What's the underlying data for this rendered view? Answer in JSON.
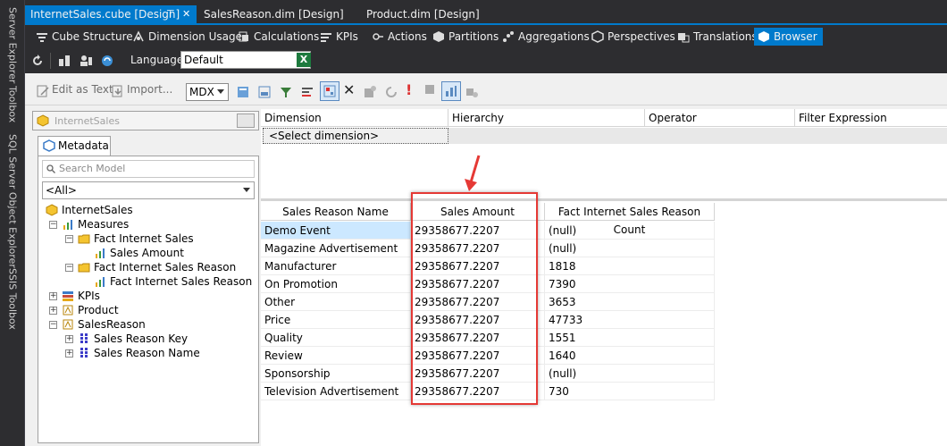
{
  "side_tabs": [
    "Server Explorer",
    "Toolbox",
    "SQL Server Object Explorer",
    "SSIS Toolbox"
  ],
  "doc_tabs": [
    {
      "label": "InternetSales.cube [Design]",
      "active": true
    },
    {
      "label": "SalesReason.dim [Design]",
      "active": false
    },
    {
      "label": "Product.dim [Design]",
      "active": false
    }
  ],
  "designer_tabs": [
    "Cube Structure",
    "Dimension Usage",
    "Calculations",
    "KPIs",
    "Actions",
    "Partitions",
    "Aggregations",
    "Perspectives",
    "Translations",
    "Browser"
  ],
  "toolbar2": {
    "language_label": "Language:",
    "language_value": "Default"
  },
  "toolbar3": {
    "edit_as_text": "Edit as Text",
    "import": "Import...",
    "query_type": "MDX"
  },
  "metadata": {
    "cube_name": "InternetSales",
    "tab_label": "Metadata",
    "search_placeholder": "Search Model",
    "filter_value": "<All>",
    "tree": [
      {
        "label": "InternetSales"
      },
      {
        "label": "Measures"
      },
      {
        "label": "Fact Internet Sales"
      },
      {
        "label": "Sales Amount"
      },
      {
        "label": "Fact Internet Sales Reason"
      },
      {
        "label": "Fact Internet Sales Reason Co"
      },
      {
        "label": "KPIs"
      },
      {
        "label": "Product"
      },
      {
        "label": "SalesReason"
      },
      {
        "label": "Sales Reason Key"
      },
      {
        "label": "Sales Reason Name"
      }
    ]
  },
  "filter": {
    "headers": [
      "Dimension",
      "Hierarchy",
      "Operator",
      "Filter Expression"
    ],
    "select_dimension": "<Select dimension>"
  },
  "results": {
    "headers": [
      "Sales Reason Name",
      "Sales Amount",
      "Fact Internet Sales Reason Count"
    ],
    "rows": [
      [
        "Demo Event",
        "29358677.2207",
        "(null)"
      ],
      [
        "Magazine Advertisement",
        "29358677.2207",
        "(null)"
      ],
      [
        "Manufacturer",
        "29358677.2207",
        "1818"
      ],
      [
        "On Promotion",
        "29358677.2207",
        "7390"
      ],
      [
        "Other",
        "29358677.2207",
        "3653"
      ],
      [
        "Price",
        "29358677.2207",
        "47733"
      ],
      [
        "Quality",
        "29358677.2207",
        "1551"
      ],
      [
        "Review",
        "29358677.2207",
        "1640"
      ],
      [
        "Sponsorship",
        "29358677.2207",
        "(null)"
      ],
      [
        "Television  Advertisement",
        "29358677.2207",
        "730"
      ]
    ]
  },
  "colors": {
    "accent": "#007acc",
    "annotation": "#e53935",
    "selected_row": "#cce8ff"
  }
}
